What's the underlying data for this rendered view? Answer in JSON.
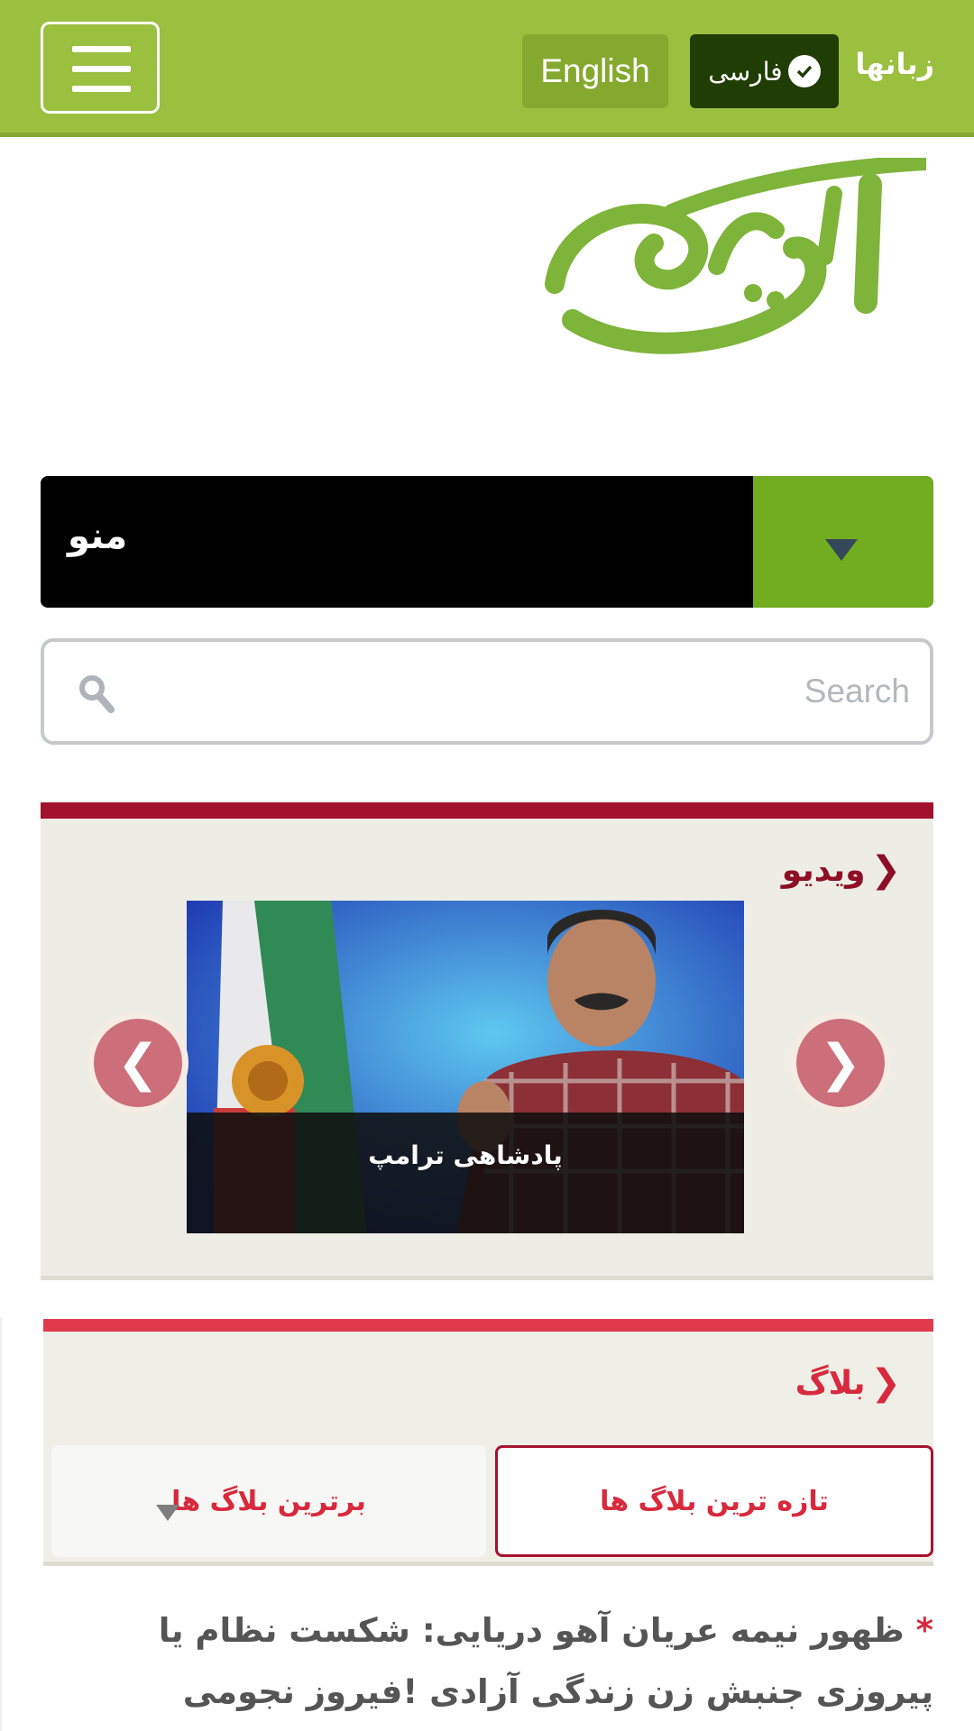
{
  "header": {
    "menu_button": "menu",
    "lang_english": "English",
    "lang_farsi": "فارسی",
    "languages_label": "زبانها",
    "bar_color": "#9bbf3f"
  },
  "logo": {
    "alt": "آیرو",
    "color": "#7fb43a"
  },
  "menu": {
    "label": "منو"
  },
  "search": {
    "placeholder": "Search"
  },
  "video": {
    "title": "ویدیو",
    "slide_caption": "پادشاهی ترامپ",
    "accent": "#a2112e"
  },
  "blog": {
    "title": "بلاگ",
    "tabs": [
      {
        "label": "تازه ترین بلاگ ها",
        "active": true
      },
      {
        "label": "برترین بلاگ ها",
        "active": false
      }
    ],
    "accent": "#e23a4d"
  },
  "article": {
    "marker": "*",
    "headline": "ظهور نیمه عریان آهو دریایی: شکست نظام یا پیروزی جنبش زن زندگی آزادی !فیروز نجومی"
  },
  "icons": [
    "menu-icon",
    "check-icon",
    "chevron-down-icon",
    "search-icon",
    "chevron-left-icon",
    "chevron-right-icon"
  ]
}
